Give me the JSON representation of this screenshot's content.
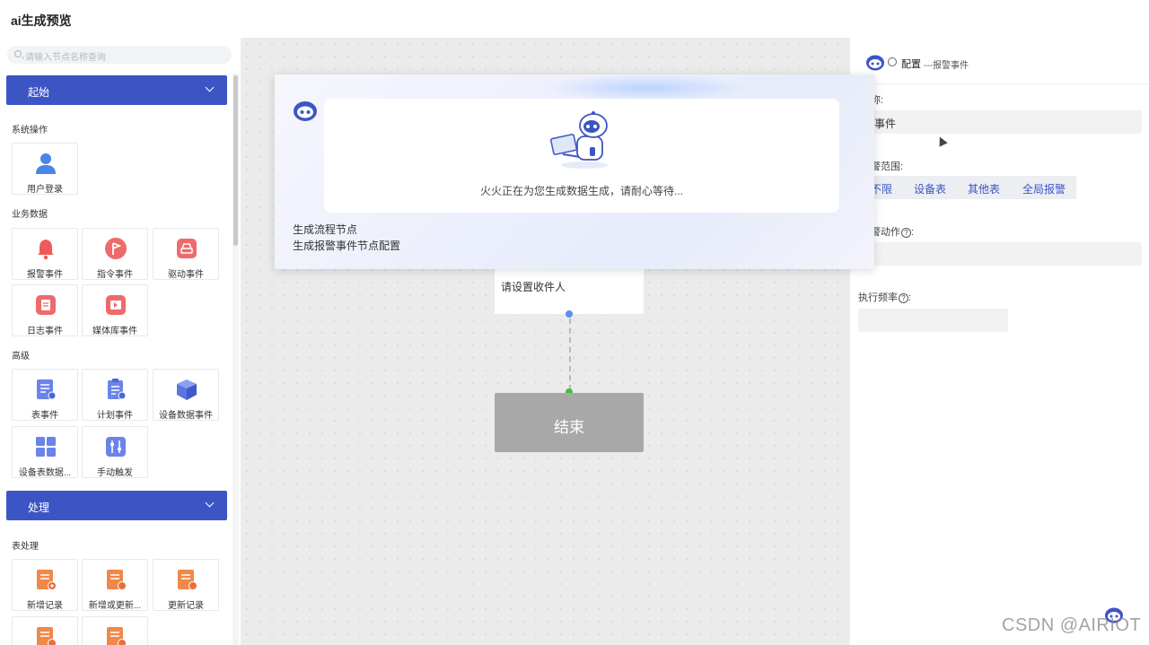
{
  "app": {
    "title": "ai生成预览"
  },
  "search": {
    "placeholder": "请输入节点名称查询"
  },
  "sidebar": {
    "sections": [
      {
        "label": "起始"
      },
      {
        "label": "处理"
      }
    ],
    "groups": {
      "system": {
        "title": "系统操作",
        "tiles": [
          {
            "label": "用户登录",
            "icon": "user-icon"
          }
        ]
      },
      "business": {
        "title": "业务数据",
        "tiles": [
          {
            "label": "报警事件",
            "icon": "bell-icon"
          },
          {
            "label": "指令事件",
            "icon": "flag-icon"
          },
          {
            "label": "驱动事件",
            "icon": "drive-icon"
          },
          {
            "label": "日志事件",
            "icon": "log-icon"
          },
          {
            "label": "媒体库事件",
            "icon": "media-icon"
          }
        ]
      },
      "advanced": {
        "title": "高级",
        "tiles": [
          {
            "label": "表事件",
            "icon": "table-event-icon"
          },
          {
            "label": "计划事件",
            "icon": "schedule-icon"
          },
          {
            "label": "设备数据事件",
            "icon": "cube-icon"
          },
          {
            "label": "设备表数据...",
            "icon": "grid-icon"
          },
          {
            "label": "手动触发",
            "icon": "sliders-icon"
          }
        ]
      },
      "table_ops": {
        "title": "表处理",
        "tiles": [
          {
            "label": "新增记录",
            "icon": "add-record-icon"
          },
          {
            "label": "新增或更新...",
            "icon": "upsert-record-icon"
          },
          {
            "label": "更新记录",
            "icon": "update-record-icon"
          }
        ]
      }
    }
  },
  "canvas": {
    "recipient_node": {
      "text": "请设置收件人"
    },
    "end_node": {
      "text": "结束"
    }
  },
  "config_panel": {
    "title": "配置",
    "subtitle": "---报警事件",
    "name_label": "称:",
    "name_value": "警事件",
    "scope_label": "警范围:",
    "scope_options": [
      "不限",
      "设备表",
      "其他表",
      "全局报警"
    ],
    "action_label": "警动作",
    "frequency_label": "执行频率",
    "colon": ":"
  },
  "overlay": {
    "message": "火火正在为您生成数据生成，请耐心等待...",
    "steps": [
      "生成流程节点",
      "生成报警事件节点配置"
    ]
  },
  "watermark": "CSDN @AIRIOT",
  "colors": {
    "accent": "#3d55c4",
    "canvas": "#ebebeb",
    "end_node": "#a8a8a8"
  }
}
